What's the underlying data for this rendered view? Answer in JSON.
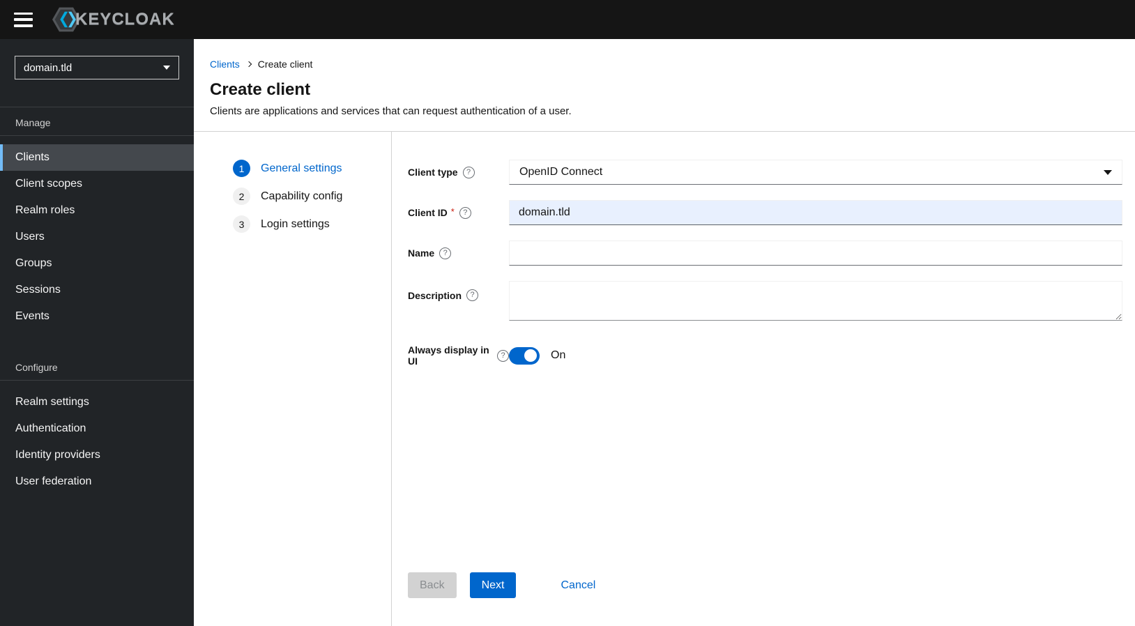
{
  "masthead": {
    "logo_text": "KEYCLOAK"
  },
  "sidebar": {
    "realm_selector": {
      "value": "domain.tld"
    },
    "sections": [
      {
        "label": "Manage",
        "items": [
          {
            "label": "Clients",
            "active": true
          },
          {
            "label": "Client scopes"
          },
          {
            "label": "Realm roles"
          },
          {
            "label": "Users"
          },
          {
            "label": "Groups"
          },
          {
            "label": "Sessions"
          },
          {
            "label": "Events"
          }
        ]
      },
      {
        "label": "Configure",
        "items": [
          {
            "label": "Realm settings"
          },
          {
            "label": "Authentication"
          },
          {
            "label": "Identity providers"
          },
          {
            "label": "User federation"
          }
        ]
      }
    ]
  },
  "breadcrumb": {
    "items": [
      {
        "label": "Clients"
      },
      {
        "label": "Create client"
      }
    ]
  },
  "page": {
    "title": "Create client",
    "description": "Clients are applications and services that can request authentication of a user."
  },
  "wizard": {
    "steps": [
      {
        "number": "1",
        "label": "General settings",
        "active": true
      },
      {
        "number": "2",
        "label": "Capability config",
        "active": false
      },
      {
        "number": "3",
        "label": "Login settings",
        "active": false
      }
    ]
  },
  "form": {
    "client_type": {
      "label": "Client type",
      "value": "OpenID Connect"
    },
    "client_id": {
      "label": "Client ID",
      "required_marker": "*",
      "value": "domain.tld"
    },
    "name": {
      "label": "Name",
      "value": ""
    },
    "description": {
      "label": "Description",
      "value": ""
    },
    "always_display": {
      "label": "Always display in UI",
      "state_label": "On",
      "enabled": true
    }
  },
  "actions": {
    "back": "Back",
    "next": "Next",
    "cancel": "Cancel"
  },
  "icons": {
    "help_glyph": "?"
  },
  "colors": {
    "primary_blue": "#0066cc",
    "sidebar_accent_blue": "#73bcf7",
    "required_red": "#c9190b",
    "autofill_bg": "#e8f0fe",
    "masthead_bg": "#151515",
    "sidebar_bg": "#212427"
  }
}
